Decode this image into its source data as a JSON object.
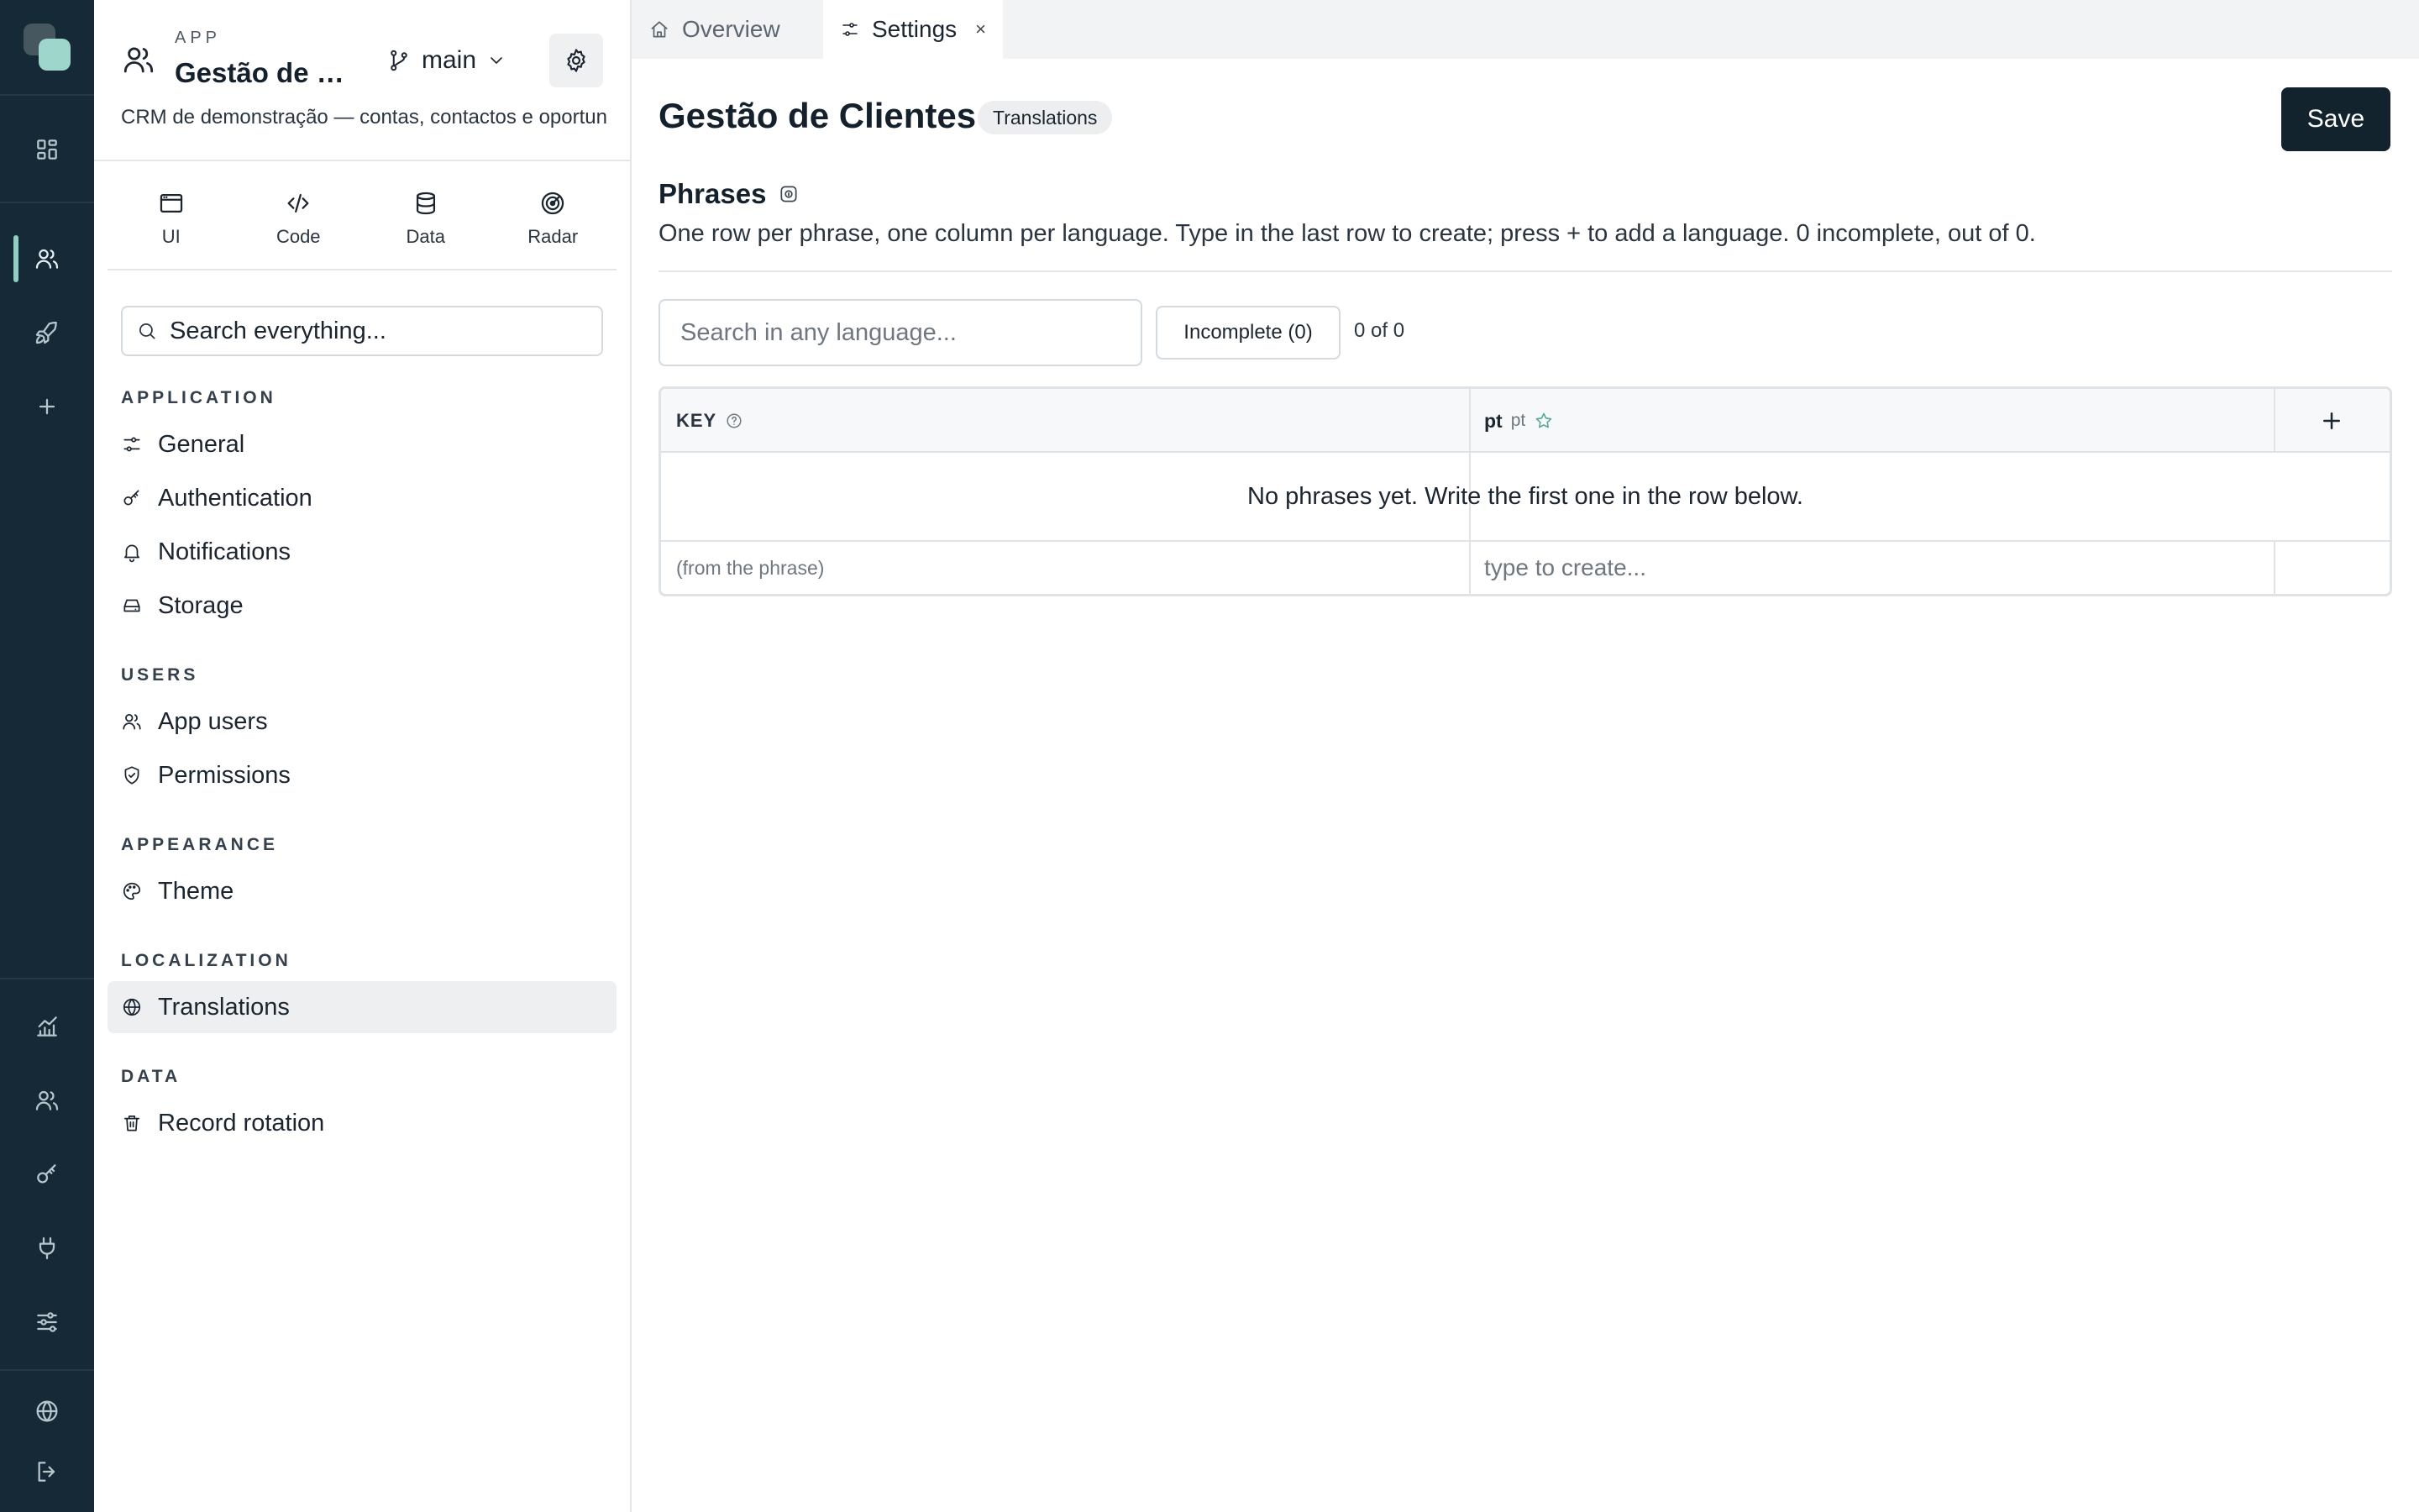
{
  "rail": {
    "items": [
      {
        "icon": "dashboard-icon"
      },
      {
        "icon": "users-icon",
        "active": true
      },
      {
        "icon": "rocket-icon"
      },
      {
        "icon": "plus-icon"
      },
      {
        "icon": "chart-icon"
      },
      {
        "icon": "team-icon"
      },
      {
        "icon": "key-icon"
      },
      {
        "icon": "plug-icon"
      },
      {
        "icon": "sliders-icon"
      },
      {
        "icon": "globe-icon"
      },
      {
        "icon": "logout-icon"
      }
    ],
    "accent_color": "#8fd0c3",
    "background_color": "#152a36"
  },
  "app": {
    "kicker": "APP",
    "title": "Gestão de Clientes",
    "branch": "main",
    "description": "CRM de demonstração — contas, contactos e oportunidades"
  },
  "modes": [
    {
      "label": "UI",
      "icon": "window-icon"
    },
    {
      "label": "Code",
      "icon": "code-icon"
    },
    {
      "label": "Data",
      "icon": "database-icon"
    },
    {
      "label": "Radar",
      "icon": "radar-icon"
    }
  ],
  "search": {
    "placeholder": "Search everything..."
  },
  "nav": {
    "sections": [
      {
        "label": "APPLICATION",
        "items": [
          {
            "label": "General",
            "icon": "sliders-small-icon"
          },
          {
            "label": "Authentication",
            "icon": "key-icon"
          },
          {
            "label": "Notifications",
            "icon": "bell-icon"
          },
          {
            "label": "Storage",
            "icon": "drive-icon"
          }
        ]
      },
      {
        "label": "USERS",
        "items": [
          {
            "label": "App users",
            "icon": "users-icon"
          },
          {
            "label": "Permissions",
            "icon": "shield-check-icon"
          }
        ]
      },
      {
        "label": "APPEARANCE",
        "items": [
          {
            "label": "Theme",
            "icon": "palette-icon"
          }
        ]
      },
      {
        "label": "LOCALIZATION",
        "items": [
          {
            "label": "Translations",
            "icon": "globe-icon",
            "active": true
          }
        ]
      },
      {
        "label": "DATA",
        "items": [
          {
            "label": "Record rotation",
            "icon": "trash-icon"
          }
        ]
      }
    ]
  },
  "tabs": [
    {
      "label": "Overview",
      "icon": "home-icon",
      "active": false
    },
    {
      "label": "Settings",
      "icon": "sliders-small-icon",
      "active": true,
      "close": "×"
    }
  ],
  "page": {
    "title": "Gestão de Clientes",
    "badge": "Translations",
    "save_label": "Save"
  },
  "phrases": {
    "title": "Phrases",
    "description": "One row per phrase, one column per language. Type in the last row to create; press + to add a language. 0 incomplete, out of 0.",
    "search_placeholder": "Search in any language...",
    "filter_label": "Incomplete (0)",
    "count_label": "0 of 0",
    "columns": {
      "key_label": "KEY",
      "lang_code": "pt",
      "lang_sub": "pt",
      "add_label": "+"
    },
    "empty_message": "No phrases yet. Write the first one in the row below.",
    "new_row": {
      "key_placeholder": "(from the phrase)",
      "value_placeholder": "type to create..."
    }
  }
}
